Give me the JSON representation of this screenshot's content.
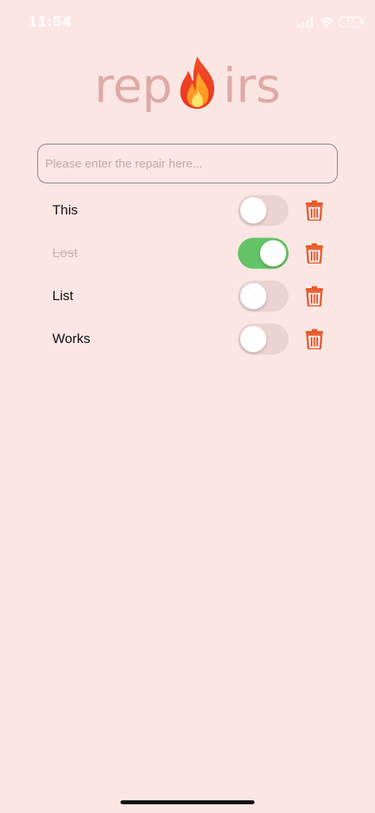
{
  "status_bar": {
    "time": "11:54",
    "battery_level": "77",
    "icons": [
      "signal-icon",
      "wifi-icon",
      "battery-icon"
    ]
  },
  "title": {
    "before": "rep",
    "icon": "flame-icon",
    "after": "irs"
  },
  "input": {
    "value": "",
    "placeholder": "Please enter the repair here..."
  },
  "items": [
    {
      "label": "This",
      "done": false
    },
    {
      "label": "Lost",
      "done": true
    },
    {
      "label": "List",
      "done": false
    },
    {
      "label": "Works",
      "done": false
    }
  ],
  "colors": {
    "background": "#fbe6e4",
    "title": "#dfa9a6",
    "toggle_on": "#62c466",
    "toggle_off": "#ebd3d2",
    "trash": "#e8592a"
  }
}
